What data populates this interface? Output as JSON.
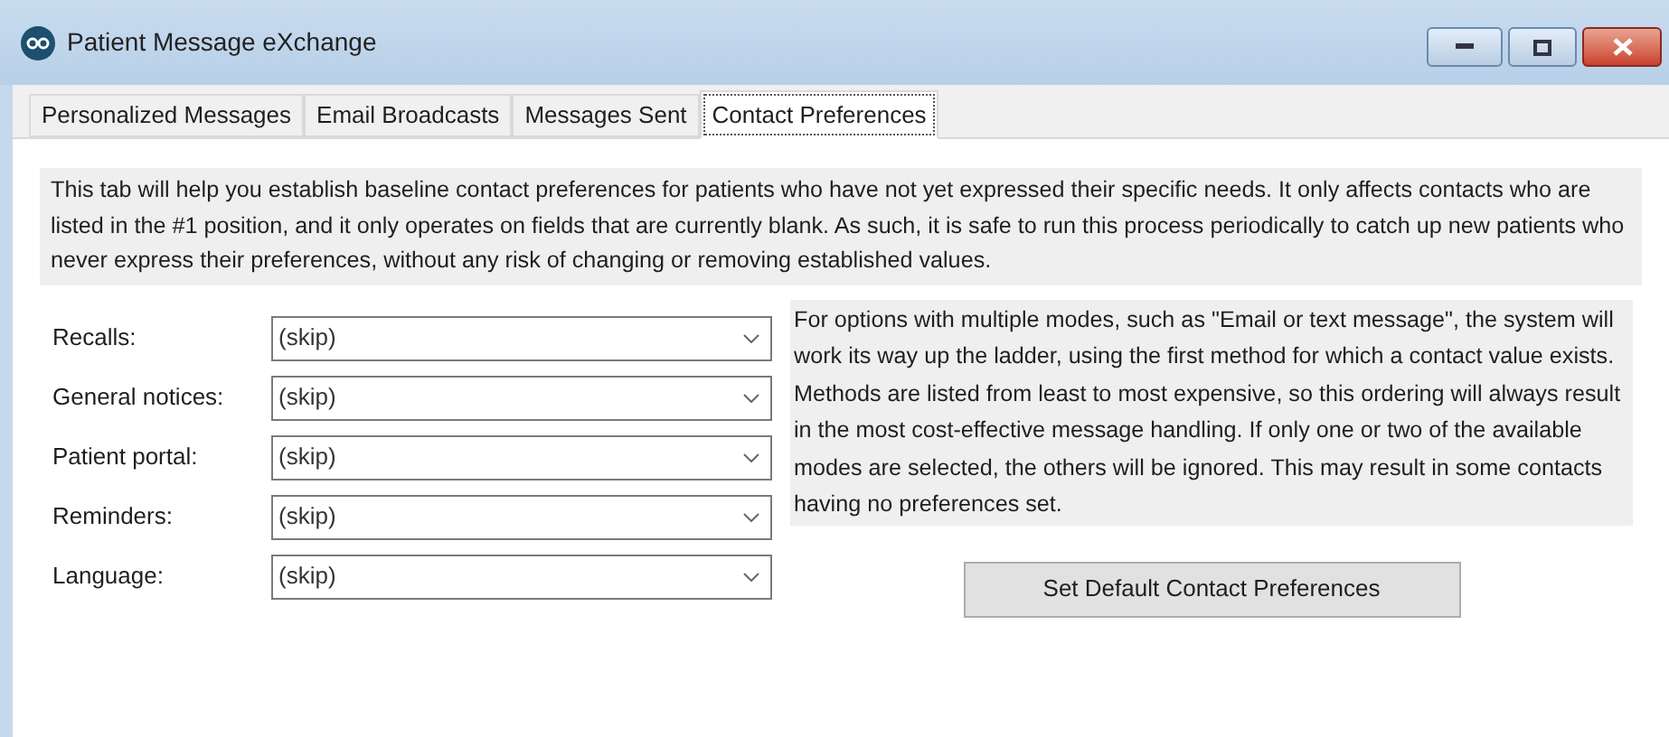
{
  "window": {
    "title": "Patient Message eXchange"
  },
  "tabs": [
    {
      "label": "Personalized Messages",
      "selected": false
    },
    {
      "label": "Email Broadcasts",
      "selected": false
    },
    {
      "label": "Messages Sent",
      "selected": false
    },
    {
      "label": "Contact Preferences",
      "selected": true
    }
  ],
  "intro": "This tab will help you establish baseline contact preferences for patients who have not yet expressed their specific needs. It only affects contacts who are listed in the #1 position, and it only operates on fields that are currently blank. As such, it is safe to run this process periodically to catch up new patients who never express their preferences, without any risk of changing or removing established values.",
  "fields": [
    {
      "label": "Recalls:",
      "value": "(skip)"
    },
    {
      "label": "General notices:",
      "value": "(skip)"
    },
    {
      "label": "Patient portal:",
      "value": "(skip)"
    },
    {
      "label": "Reminders:",
      "value": "(skip)"
    },
    {
      "label": "Language:",
      "value": "(skip)"
    }
  ],
  "note": "For options with multiple modes, such as \"Email or text message\", the system will work its way up the ladder, using the first method for which a contact value exists. Methods are listed from least to most expensive, so this ordering will always result in the most cost-effective message handling. If only one or two of the available modes are selected, the others will be ignored. This may result in some contacts having no preferences set.",
  "button": "Set Default Contact Preferences"
}
